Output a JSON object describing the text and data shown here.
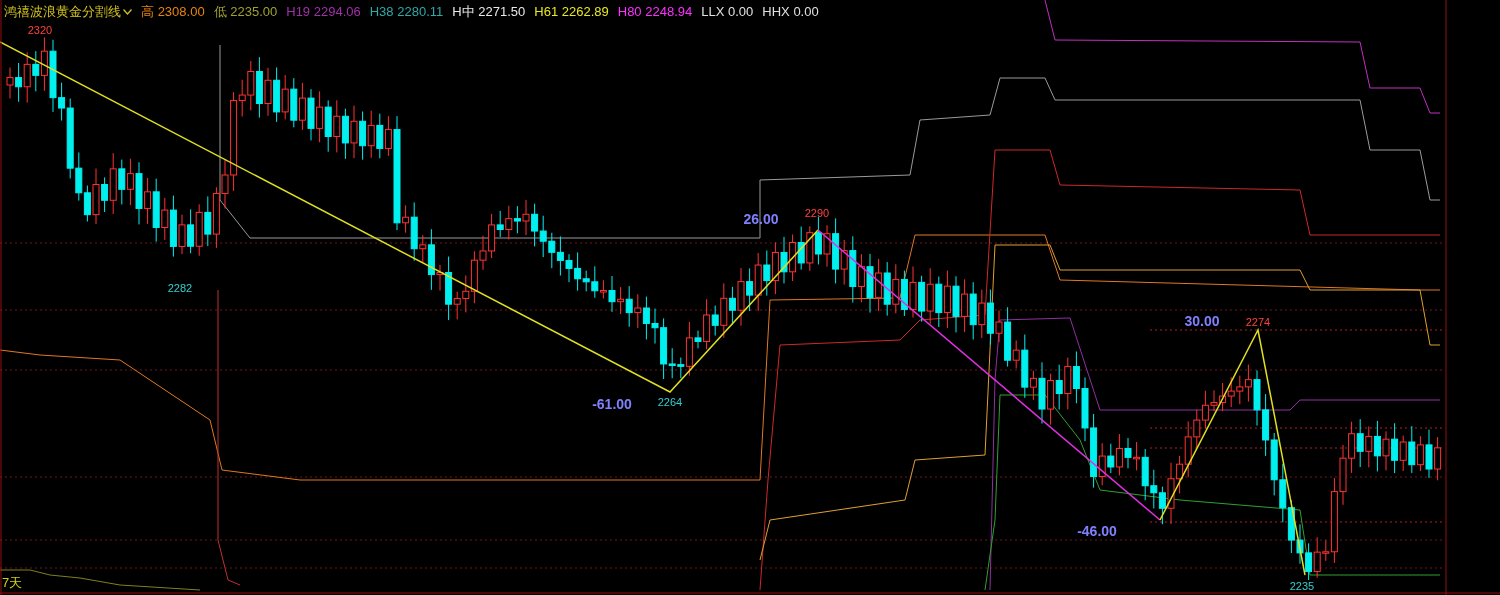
{
  "indicator": {
    "name": "鸿禧波浪黄金分割线"
  },
  "legend": [
    {
      "label": "高",
      "value": "2308.00",
      "color": "#e8840c"
    },
    {
      "label": "低",
      "value": "2235.00",
      "color": "#a0a030"
    },
    {
      "label": "H19",
      "value": "2294.06",
      "color": "#a030a8"
    },
    {
      "label": "H38",
      "value": "2280.11",
      "color": "#30a8a8"
    },
    {
      "label": "H中",
      "value": "2271.50",
      "color": "#e8e8e8"
    },
    {
      "label": "H61",
      "value": "2262.89",
      "color": "#e8e820"
    },
    {
      "label": "H80",
      "value": "2248.94",
      "color": "#ff30ff"
    },
    {
      "label": "LLX",
      "value": "0.00",
      "color": "#e0e0e0"
    },
    {
      "label": "HHX",
      "value": "0.00",
      "color": "#e0e0e0"
    }
  ],
  "annotations": [
    {
      "kind": "high",
      "text": "2320"
    },
    {
      "kind": "low",
      "text": "2282"
    },
    {
      "kind": "swing",
      "text": "-61.00"
    },
    {
      "kind": "low",
      "text": "2264"
    },
    {
      "kind": "swing",
      "text": "26.00"
    },
    {
      "kind": "high",
      "text": "2290"
    },
    {
      "kind": "swing",
      "text": "-46.00"
    },
    {
      "kind": "swing",
      "text": "30.00"
    },
    {
      "kind": "high",
      "text": "2274"
    },
    {
      "kind": "low",
      "text": "2235"
    }
  ],
  "period_label": "7天"
}
